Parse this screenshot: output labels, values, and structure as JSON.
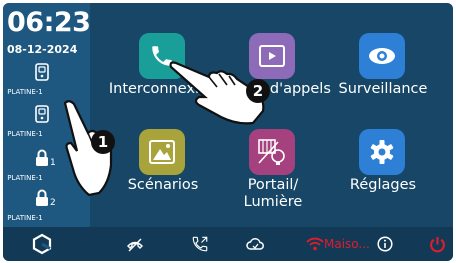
{
  "clock": {
    "time": "06:23",
    "date": "08-12-2024"
  },
  "sidebar": {
    "platines": [
      {
        "label": "PLATINE-1",
        "number": "",
        "style": "outline"
      },
      {
        "label": "PLATINE-1",
        "number": "",
        "style": "outline"
      },
      {
        "label": "PLATINE-1",
        "number": "1",
        "style": "solid"
      },
      {
        "label": "PLATINE-1",
        "number": "2",
        "style": "solid"
      }
    ]
  },
  "tiles": [
    {
      "id": "interphone",
      "label": "Interconnexion",
      "icon": "phone-icon",
      "color": "#1a9e9a"
    },
    {
      "id": "journal",
      "label": "Journal d'appels",
      "icon": "video-list-icon",
      "color": "#8e6bb8"
    },
    {
      "id": "surveillance",
      "label": "Surveillance",
      "icon": "eye-icon",
      "color": "#2e7fd6"
    },
    {
      "id": "scenarios",
      "label": "Scénarios",
      "icon": "mountain-icon",
      "color": "#a8a33a"
    },
    {
      "id": "portail",
      "label": "Portail/\nLumière",
      "icon": "gate-bulb-icon",
      "color": "#a4417e"
    },
    {
      "id": "reglages",
      "label": "Réglages",
      "icon": "gear-icon",
      "color": "#2e7fd6"
    }
  ],
  "bottom_bar": {
    "wifi_label": "Maiso...",
    "icons": [
      "logo-icon",
      "hangup-icon",
      "call-forward-icon",
      "cloud-icon",
      "wifi-icon",
      "info-icon",
      "power-icon"
    ]
  },
  "annotations": {
    "badge_1": "1",
    "badge_2": "2"
  }
}
